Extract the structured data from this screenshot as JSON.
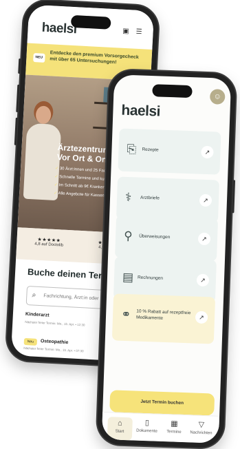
{
  "back_phone": {
    "logo": "haelsi",
    "header_icons": [
      "calendar-icon",
      "menu-icon"
    ],
    "banner": {
      "badge": "NEU",
      "text": "Entdecke den premium Vorsorgecheck mit über 65 Untersuchungen!"
    },
    "hero": {
      "title": "Ärztezentrum 1180, Vor Ort & Online",
      "bullets": [
        "30 Ärzt:innen und 25 Fachrichtungen",
        "Schnelle Termine und kurze Wartezeiten",
        "Im Schnitt ab 9€ Krankenkassentarif",
        "Alle Angebote für Kassenpatient:innen"
      ]
    },
    "ratings": [
      {
        "stars": "★★★★★",
        "label": "4,8 auf Doctolib"
      },
      {
        "stars": "★★★",
        "label": "4,9 auf"
      }
    ],
    "booking": {
      "title": "Buche deinen Termin",
      "search_placeholder": "Fachrichtung, Ärzt:in oder",
      "appointments": [
        {
          "name": "Kinderarzt",
          "next": "Nächster freier Termin: Mo., 15. Apr. • 12:30"
        },
        {
          "badge": "Neu",
          "name": "Osteopathie",
          "next": "Nächster freier Termin: Mo., 15. Apr. • 07:30"
        }
      ]
    }
  },
  "front_phone": {
    "logo": "haelsi",
    "avatar_icon": "user-icon",
    "cards": [
      {
        "label": "Rezepte",
        "icon": "prescription-icon"
      },
      {
        "label": "Arztbriefe",
        "icon": "doctor-letter-icon"
      },
      {
        "label": "Überweisungen",
        "icon": "stethoscope-icon"
      },
      {
        "label": "Rechnungen",
        "icon": "invoice-icon"
      },
      {
        "label": "10 % Rabatt auf rezeptfreie Medikamente",
        "icon": "pills-icon"
      }
    ],
    "cta": "Jetzt Termin buchen",
    "tabs": [
      {
        "label": "Start",
        "icon": "home-icon"
      },
      {
        "label": "Dokumente",
        "icon": "documents-icon"
      },
      {
        "label": "Termine",
        "icon": "calendar-icon"
      },
      {
        "label": "Nachrichten",
        "icon": "messages-icon"
      }
    ]
  }
}
